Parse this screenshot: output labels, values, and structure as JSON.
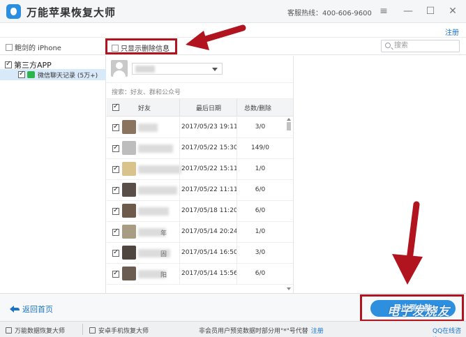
{
  "app": {
    "title": "万能苹果恢复大师",
    "hotline": "客服热线：400-606-9600",
    "register": "注册"
  },
  "toolbar": {
    "device": "鲍剑的 iPhone",
    "only_deleted": "只显示删除信息",
    "search_placeholder": "搜索"
  },
  "tree": {
    "root": "第三方APP",
    "child": "微信聊天记录 (5万+)"
  },
  "friend_panel": {
    "search_hint": "搜索：好友、群和公众号",
    "headers": {
      "friend": "好友",
      "last_date": "最后日期",
      "total_deleted": "总数/删除"
    },
    "rows": [
      {
        "date": "2017/05/23 19:11",
        "count": "3/0"
      },
      {
        "date": "2017/05/22 15:30",
        "count": "149/0"
      },
      {
        "date": "2017/05/22 15:11",
        "count": "1/0"
      },
      {
        "date": "2017/05/22 11:11",
        "count": "6/0"
      },
      {
        "date": "2017/05/18 11:20",
        "count": "6/0"
      },
      {
        "date": "2017/05/14 20:24",
        "count": "1/0"
      },
      {
        "date": "2017/05/14 16:50",
        "count": "3/0"
      },
      {
        "date": "2017/05/14 15:56",
        "count": "6/0"
      }
    ],
    "visible_nick_fragments": [
      "年",
      "固",
      "阳"
    ]
  },
  "actions": {
    "back": "返回首页",
    "export": "导出到电脑"
  },
  "status": {
    "item1": "万能数据恢复大师",
    "item2": "安卓手机恢复大师",
    "note": "非会员用户预览数据时部分用\"*\"号代替",
    "register": "注册",
    "qq": "QQ在线咨询"
  },
  "watermark": "电子发烧友",
  "colors": {
    "accent": "#2d8fde",
    "highlight_box": "#b1141e",
    "link": "#1a73c9",
    "wechat": "#2db54b"
  }
}
